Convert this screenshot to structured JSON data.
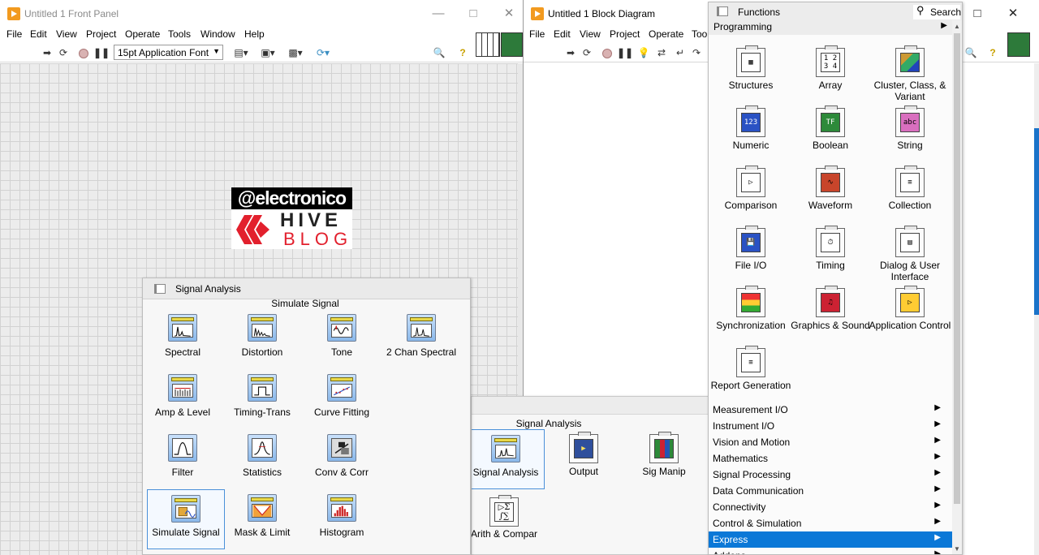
{
  "front_panel": {
    "title": "Untitled 1 Front Panel",
    "menus": [
      "File",
      "Edit",
      "View",
      "Project",
      "Operate",
      "Tools",
      "Window",
      "Help"
    ],
    "font_select": "15pt Application Font"
  },
  "block_diagram": {
    "title": "Untitled 1 Block Diagram",
    "menus": [
      "File",
      "Edit",
      "View",
      "Project",
      "Operate",
      "Tool"
    ]
  },
  "logo": {
    "line1": "@electronico",
    "line2": "HIVE",
    "line3": "BLOG"
  },
  "functions_palette": {
    "title": "Functions",
    "search_label": "Search",
    "category": "Programming",
    "items": [
      {
        "label": "Structures",
        "icon": "structures-icon"
      },
      {
        "label": "Array",
        "icon": "array-icon"
      },
      {
        "label": "Cluster, Class, & Variant",
        "icon": "cluster-icon"
      },
      {
        "label": "Numeric",
        "icon": "numeric-icon"
      },
      {
        "label": "Boolean",
        "icon": "boolean-icon"
      },
      {
        "label": "String",
        "icon": "string-icon"
      },
      {
        "label": "Comparison",
        "icon": "comparison-icon"
      },
      {
        "label": "Waveform",
        "icon": "waveform-icon"
      },
      {
        "label": "Collection",
        "icon": "collection-icon"
      },
      {
        "label": "File I/O",
        "icon": "file-io-icon"
      },
      {
        "label": "Timing",
        "icon": "timing-icon"
      },
      {
        "label": "Dialog & User Interface",
        "icon": "dialog-icon"
      },
      {
        "label": "Synchronization",
        "icon": "synchronization-icon"
      },
      {
        "label": "Graphics & Sound",
        "icon": "graphics-sound-icon"
      },
      {
        "label": "Application Control",
        "icon": "application-control-icon"
      },
      {
        "label": "Report Generation",
        "icon": "report-generation-icon"
      }
    ],
    "categories": [
      "Measurement I/O",
      "Instrument I/O",
      "Vision and Motion",
      "Mathematics",
      "Signal Processing",
      "Data Communication",
      "Connectivity",
      "Control & Simulation",
      "Express",
      "Addons"
    ],
    "active_category": "Express"
  },
  "signal_analysis_palette": {
    "title": "Signal Analysis",
    "subtitle": "Simulate Signal",
    "items": [
      {
        "label": "Spectral",
        "icon": "spectral-icon"
      },
      {
        "label": "Distortion",
        "icon": "distortion-icon"
      },
      {
        "label": "Tone",
        "icon": "tone-icon"
      },
      {
        "label": "2 Chan Spectral",
        "icon": "two-chan-spectral-icon"
      },
      {
        "label": "Amp & Level",
        "icon": "amp-level-icon"
      },
      {
        "label": "Timing-Trans",
        "icon": "timing-trans-icon"
      },
      {
        "label": "Curve Fitting",
        "icon": "curve-fitting-icon"
      },
      {
        "label": "Filter",
        "icon": "filter-icon"
      },
      {
        "label": "Statistics",
        "icon": "statistics-icon"
      },
      {
        "label": "Conv & Corr",
        "icon": "conv-corr-icon"
      },
      {
        "label": "Simulate Signal",
        "icon": "simulate-signal-icon"
      },
      {
        "label": "Mask & Limit",
        "icon": "mask-limit-icon"
      },
      {
        "label": "Histogram",
        "icon": "histogram-icon"
      }
    ]
  },
  "express_palette": {
    "title": "Signal Analysis",
    "items": [
      {
        "label": "Signal Analysis",
        "icon": "signal-analysis-icon"
      },
      {
        "label": "Output",
        "icon": "output-icon"
      },
      {
        "label": "Sig Manip",
        "icon": "sig-manip-icon"
      },
      {
        "label": "Arith & Compar",
        "icon": "arith-compar-icon"
      }
    ]
  }
}
